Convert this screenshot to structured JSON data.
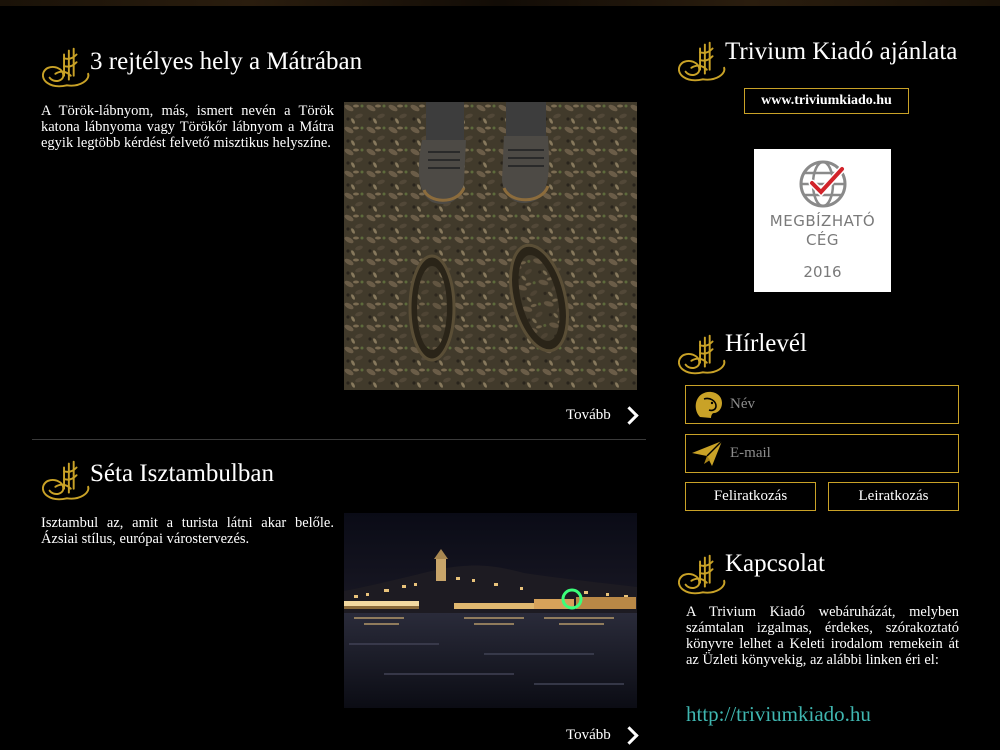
{
  "posts": [
    {
      "title": "3 rejtélyes hely a Mátrában",
      "excerpt": "A Török-lábnyom, más, ismert nevén a Török katona lábnyoma vagy Törökőr lábnyom a Mátra egyik legtöbb kérdést felvető misztikus helyszíne.",
      "more_label": "Tovább"
    },
    {
      "title": "Séta Isztambulban",
      "excerpt": "Isztambul az, amit a turista látni akar belőle. Ázsiai stílus, európai várostervezés.",
      "more_label": "Tovább"
    }
  ],
  "sidebar": {
    "offer": {
      "title": "Trivium Kiadó ajánlata",
      "url_label": "www.triviumkiado.hu",
      "badge_line1": "MEGBÍZHATÓ",
      "badge_line2": "CÉG",
      "badge_year": "2016"
    },
    "newsletter": {
      "title": "Hírlevél",
      "name_placeholder": "Név",
      "email_placeholder": "E-mail",
      "subscribe_label": "Feliratkozás",
      "unsubscribe_label": "Leiratkozás"
    },
    "contact": {
      "title": "Kapcsolat",
      "text": "A Trivium Kiadó webáruházát, melyben számtalan izgalmas, érdekes, szórakoztató könyvre lelhet a Keleti irodalom remekein át az Üzleti könyvekig, az alábbi linken éri el:",
      "link_label": "http://triviumkiado.hu"
    }
  },
  "colors": {
    "accent_gold": "#c9a227",
    "link_teal": "#3fb6b0",
    "background": "#000000"
  },
  "icons": [
    "tughra-ornament-icon",
    "woman-profile-icon",
    "paper-plane-icon",
    "chevron-right-icon",
    "globe-check-icon"
  ]
}
